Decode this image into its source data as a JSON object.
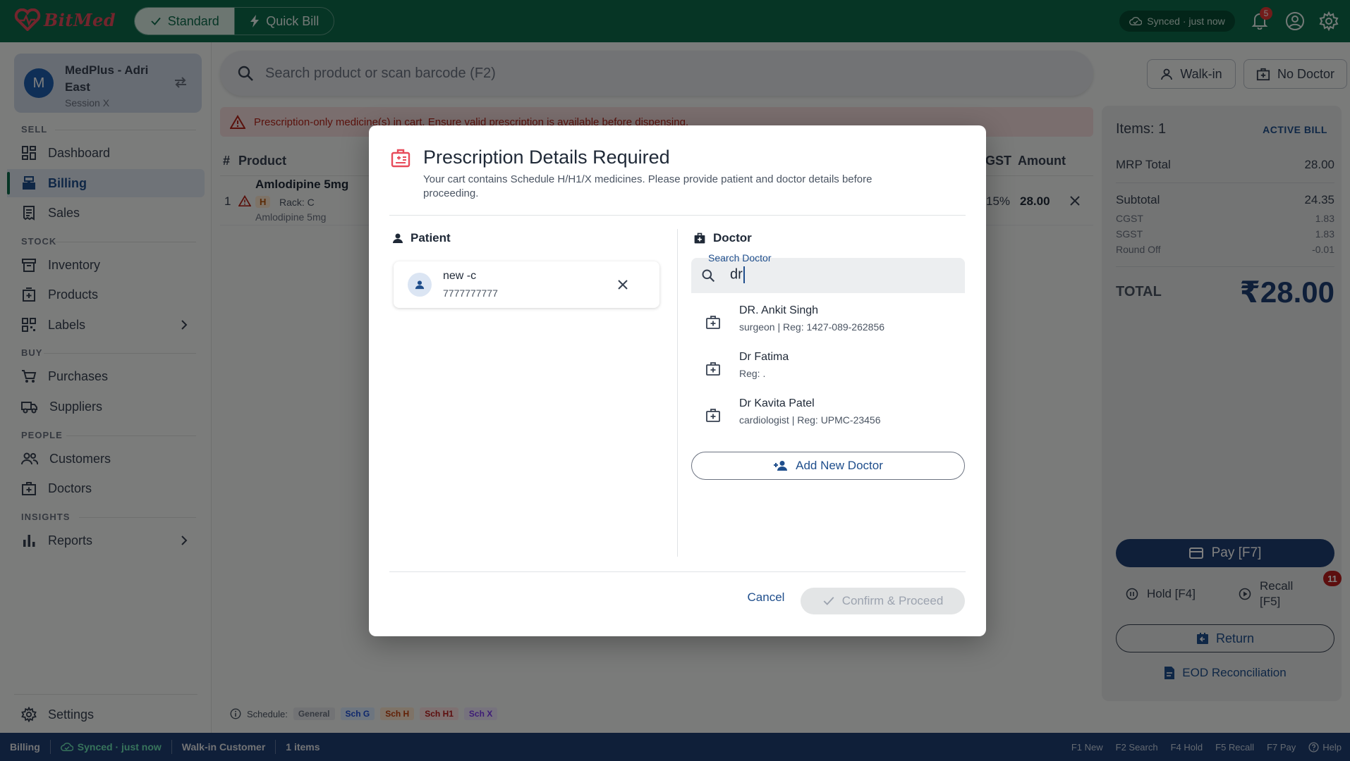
{
  "brand": {
    "name": "BitMed"
  },
  "topbar": {
    "mode_standard": "Standard",
    "mode_quick": "Quick Bill",
    "sync_status": "Synced · just now",
    "notifications_count": "5"
  },
  "store": {
    "avatar_letter": "M",
    "name": "MedPlus - Adri East",
    "session": "Session X"
  },
  "sidebar": {
    "sections": {
      "sell": "SELL",
      "stock": "STOCK",
      "buy": "BUY",
      "people": "PEOPLE",
      "insights": "INSIGHTS"
    },
    "items": {
      "dashboard": "Dashboard",
      "billing": "Billing",
      "sales": "Sales",
      "inventory": "Inventory",
      "products": "Products",
      "labels": "Labels",
      "purchases": "Purchases",
      "suppliers": "Suppliers",
      "customers": "Customers",
      "doctors": "Doctors",
      "reports": "Reports",
      "settings": "Settings"
    }
  },
  "search": {
    "placeholder": "Search product or scan barcode (F2)"
  },
  "header_buttons": {
    "walkin": "Walk-in",
    "doctor": "No Doctor"
  },
  "alert": {
    "text": "Prescription-only medicine(s) in cart. Ensure valid prescription is available before dispensing."
  },
  "cart": {
    "columns": {
      "index": "#",
      "product": "Product",
      "gst": "GST",
      "amount": "Amount"
    },
    "rows": [
      {
        "index": "1",
        "name": "Amlodipine 5mg",
        "schedule": "H",
        "rack": "Rack: C",
        "generic": "Amlodipine 5mg",
        "gst": "15%",
        "amount": "28.00"
      }
    ]
  },
  "summary": {
    "items_label": "Items: 1",
    "status": "ACTIVE BILL",
    "mrp_label": "MRP Total",
    "mrp_value": "28.00",
    "subtotal_label": "Subtotal",
    "subtotal_value": "24.35",
    "cgst_label": "CGST",
    "cgst_value": "1.83",
    "sgst_label": "SGST",
    "sgst_value": "1.83",
    "roundoff_label": "Round Off",
    "roundoff_value": "-0.01",
    "total_label": "TOTAL",
    "total_value": "₹28.00",
    "pay": "Pay  [F7]",
    "hold": "Hold [F4]",
    "recall": "Recall [F5]",
    "recall_count": "11",
    "return": "Return",
    "eod": "EOD Reconciliation"
  },
  "schedule_legend": {
    "label": "Schedule:",
    "chips": [
      "General",
      "Sch G",
      "Sch H",
      "Sch H1",
      "Sch X"
    ]
  },
  "statusbar": {
    "page": "Billing",
    "sync": "Synced · just now",
    "customer": "Walk-in Customer",
    "items": "1 items",
    "shortcuts": [
      "F1 New",
      "F2 Search",
      "F4 Hold",
      "F5 Recall",
      "F7 Pay",
      "Help"
    ]
  },
  "modal": {
    "title": "Prescription Details Required",
    "subtitle": "Your cart contains Schedule H/H1/X medicines. Please provide patient and doctor details before proceeding.",
    "patient_heading": "Patient",
    "doctor_heading": "Doctor",
    "patient": {
      "name": "new -c",
      "phone": "7777777777"
    },
    "search_label": "Search Doctor",
    "search_value": "dr",
    "doctors": [
      {
        "name": "DR. Ankit Singh",
        "meta": "surgeon | Reg: 1427-089-262856"
      },
      {
        "name": "Dr Fatima",
        "meta": "Reg: ."
      },
      {
        "name": "Dr Kavita Patel",
        "meta": "cardiologist | Reg: UPMC-23456"
      }
    ],
    "add_doctor": "Add New Doctor",
    "cancel": "Cancel",
    "confirm": "Confirm & Proceed"
  },
  "colors": {
    "primary_green": "#0c6b4a",
    "navy": "#1f3f73",
    "link_blue": "#1f4e8c",
    "danger": "#b42318"
  }
}
